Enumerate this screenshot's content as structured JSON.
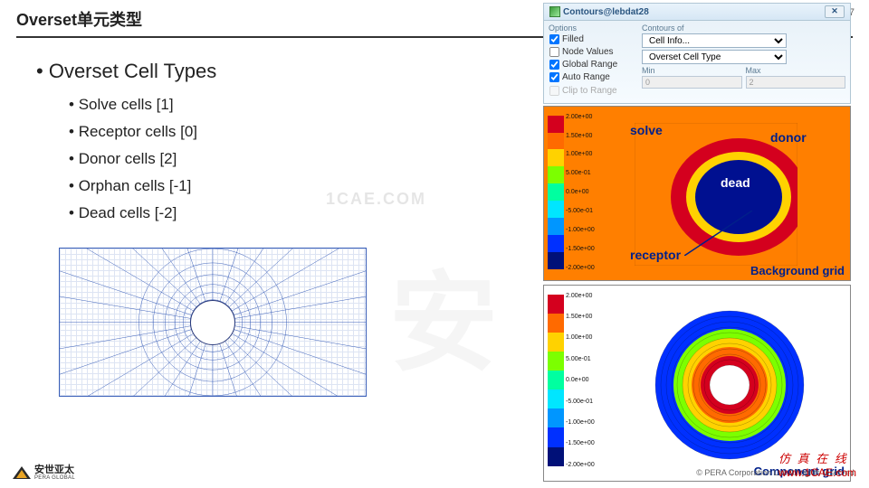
{
  "page_number": "7",
  "title": "Overset单元类型",
  "main_heading": "Overset Cell Types",
  "cell_types": [
    "Solve cells  [1]",
    "Receptor cells  [0]",
    "Donor cells  [2]",
    "Orphan cells  [-1]",
    "Dead cells  [-2]"
  ],
  "dialog": {
    "title": "Contours@lebdat28",
    "options_label": "Options",
    "checks": {
      "filled": "Filled",
      "node_values": "Node Values",
      "global_range": "Global Range",
      "auto_range": "Auto Range",
      "clip_range": "Clip to Range"
    },
    "contours_of_label": "Contours of",
    "select1": "Cell Info...",
    "select2": "Overset Cell Type",
    "min_label": "Min",
    "max_label": "Max",
    "min_val": "0",
    "max_val": "2"
  },
  "fig1": {
    "labels": {
      "solve": "solve",
      "donor": "donor",
      "dead": "dead",
      "receptor": "receptor"
    },
    "caption": "Background grid"
  },
  "fig2": {
    "caption": "Component grid"
  },
  "colorbar_values": [
    "2.00e+00",
    "1.50e+00",
    "1.00e+00",
    "5.00e-01",
    "0.0e+00",
    "-5.00e-01",
    "-1.00e+00",
    "-1.50e+00",
    "-2.00e+00"
  ],
  "colorbar_colors": [
    "#d4001e",
    "#ff6a00",
    "#ffd200",
    "#7cff00",
    "#00ffa0",
    "#00e6ff",
    "#0096ff",
    "#0030ff",
    "#001078"
  ],
  "footer": {
    "company_cn": "安世亚太",
    "company_en": "PERA GLOBAL",
    "copyright": "©   PERA Corporation Ltd. All rights reserved."
  },
  "watermarks": {
    "center_faint": "1CAE.COM",
    "big_char": "安",
    "bottom_cn": "仿 真 在 线",
    "bottom_url": "www.1CAE.com"
  }
}
